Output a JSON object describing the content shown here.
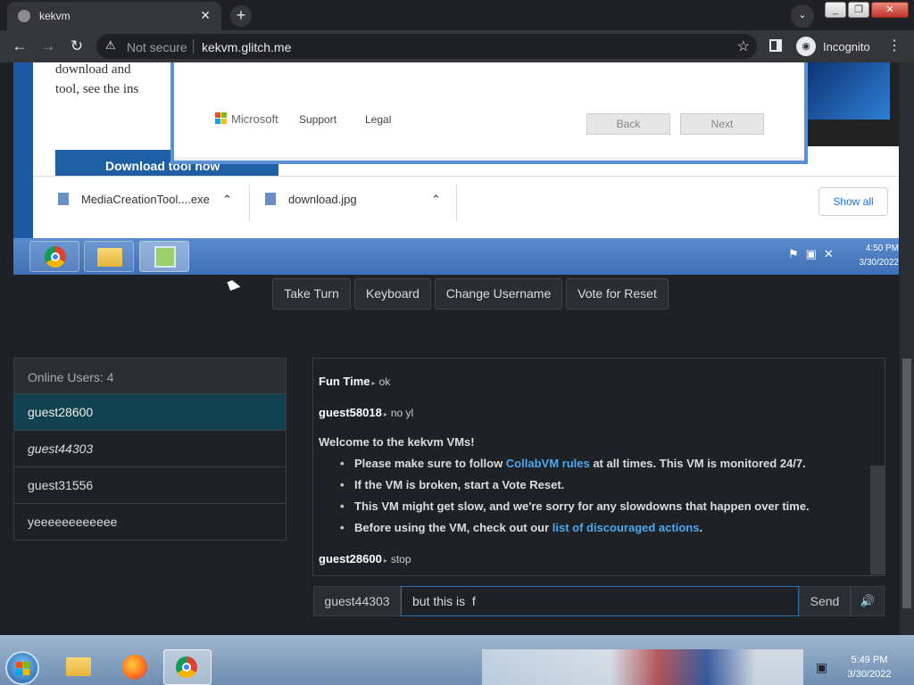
{
  "browser": {
    "tab_title": "kekvm",
    "tab_close_glyph": "✕",
    "new_tab_glyph": "+",
    "security_label": "Not secure",
    "url": "kekvm.glitch.me",
    "incognito_label": "Incognito"
  },
  "vm_screen": {
    "page_text": [
      "download and",
      "tool, see the ins"
    ],
    "download_button": "Download tool now",
    "dialog": {
      "logo_text": "Microsoft",
      "links": [
        "Support",
        "Legal"
      ],
      "buttons": [
        "Back",
        "Next"
      ]
    },
    "downloads": [
      {
        "name": "MediaCreationTool....exe"
      },
      {
        "name": "download.jpg"
      }
    ],
    "show_all": "Show all",
    "clock_time": "4:50 PM",
    "clock_date": "3/30/2022"
  },
  "controls": [
    "Take Turn",
    "Keyboard",
    "Change Username",
    "Vote for Reset"
  ],
  "users": {
    "header": "Online Users: 4",
    "list": [
      "guest28600",
      "guest44303",
      "guest31556",
      "yeeeeeeeeeeee"
    ]
  },
  "chat": {
    "messages": [
      {
        "user": "Fun Time",
        "text": "ok"
      },
      {
        "user": "guest58018",
        "text": "no yl"
      },
      {
        "user": "guest28600",
        "text": "stop"
      }
    ],
    "welcome": "Welcome to the kekvm VMs!",
    "rules": {
      "r1_pre": "Please make sure to follow ",
      "r1_link": "CollabVM rules",
      "r1_post": " at all times. This VM is monitored 24/7.",
      "r2": "If the VM is broken, start a Vote Reset.",
      "r3": "This VM might get slow, and we're sorry for any slowdowns that happen over time.",
      "r4_pre": "Before using the VM, check out our ",
      "r4_link": "list of discouraged actions",
      "r4_post": "."
    },
    "username": "guest44303",
    "input_value": "but this is  f",
    "send_label": "Send"
  },
  "host": {
    "clock_time": "5:49 PM",
    "clock_date": "3/30/2022"
  },
  "colors": {
    "accent_link": "#4ea7ee",
    "selected_user": "#124250",
    "vm_taskbar": "#3f6fb5"
  }
}
